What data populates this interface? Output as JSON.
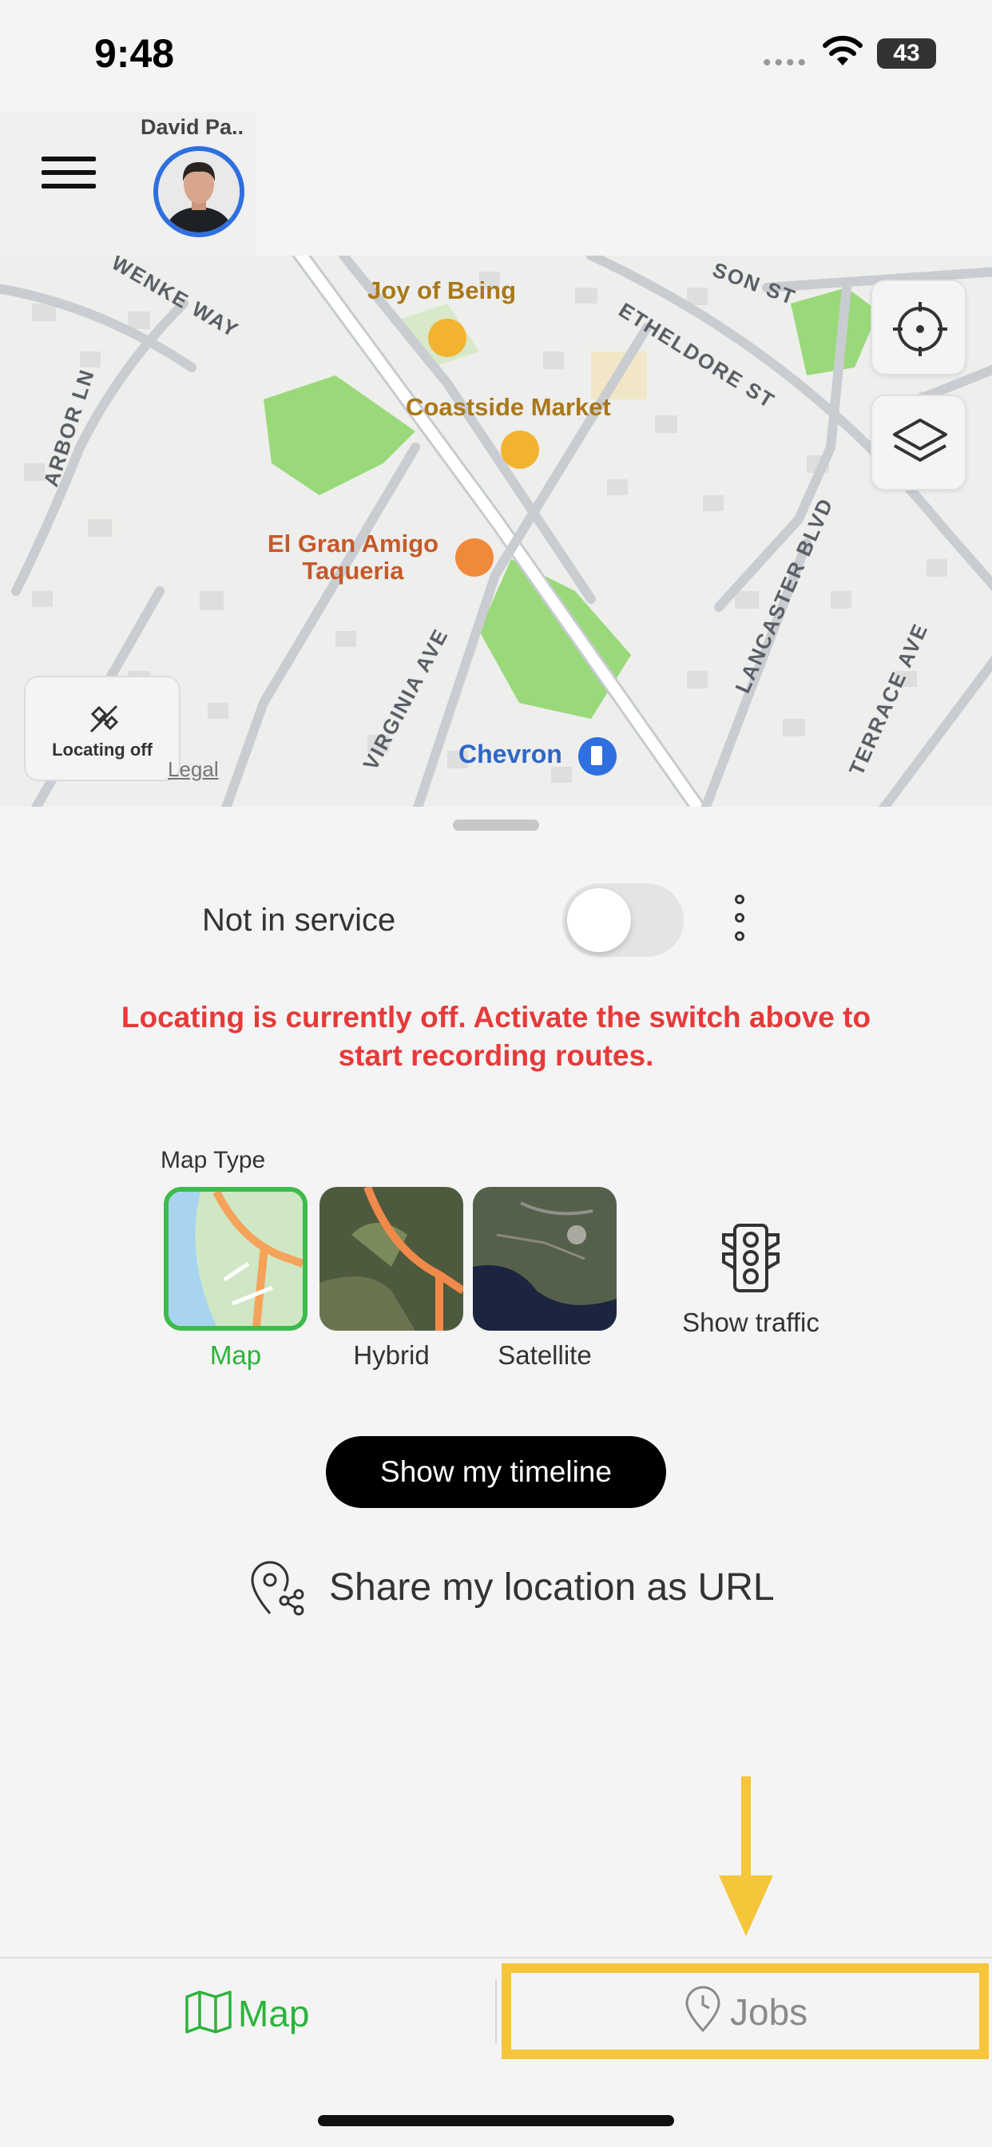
{
  "status": {
    "time": "9:48",
    "battery": "43"
  },
  "header": {
    "user_name": "David Pa.."
  },
  "map": {
    "pois": [
      "Joy of Being",
      "Coastside Market",
      "El Gran Amigo",
      "Taqueria",
      "Chevron"
    ],
    "streets": [
      "WENKE WAY",
      "ARBOR LN",
      "ETHELDORE ST",
      "SON ST",
      "VIRGINIA AVE",
      "LANCASTER BLVD",
      "TERRACE AVE"
    ],
    "locating_label": "Locating off",
    "legal": "Legal"
  },
  "service": {
    "label": "Not in service",
    "active": false
  },
  "warning": "Locating is currently off. Activate the switch above to start recording routes.",
  "map_type": {
    "title": "Map Type",
    "options": [
      {
        "label": "Map",
        "selected": true
      },
      {
        "label": "Hybrid",
        "selected": false
      },
      {
        "label": "Satellite",
        "selected": false
      }
    ],
    "traffic_label": "Show traffic"
  },
  "timeline_button": "Show my timeline",
  "share_label": "Share my location as URL",
  "tabs": {
    "map": "Map",
    "jobs": "Jobs"
  },
  "colors": {
    "accent": "#2db33c",
    "warning": "#e63a3a",
    "highlight": "#f5c53a"
  }
}
